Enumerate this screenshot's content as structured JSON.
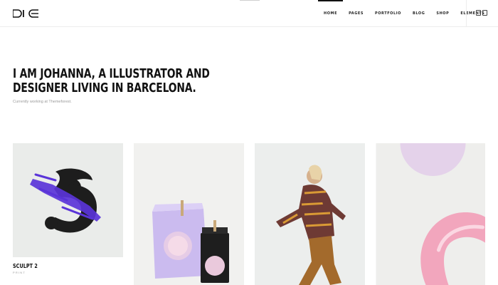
{
  "header": {
    "nav": [
      {
        "label": "HOME"
      },
      {
        "label": "PAGES"
      },
      {
        "label": "PORTFOLIO"
      },
      {
        "label": "BLOG"
      },
      {
        "label": "SHOP"
      },
      {
        "label": "ELEMENTS"
      }
    ],
    "active_nav": "HOME",
    "sidebar_toggle_icon": "two-panels-icon"
  },
  "hero": {
    "title_line1": "I AM JOHANNA, A ILLUSTRATOR AND",
    "title_line2": "DESIGNER LIVING IN BARCELONA.",
    "subtitle": "Currently working at Themeforest."
  },
  "portfolio": [
    {
      "title": "SCULPT 2",
      "category": "PRINT"
    },
    {
      "title": "",
      "category": ""
    },
    {
      "title": "",
      "category": ""
    },
    {
      "title": "",
      "category": ""
    }
  ],
  "colors": {
    "accent_purple": "#5a34d8",
    "text": "#111111",
    "muted": "#9a9a9a",
    "card_bg": "#eaecea"
  }
}
